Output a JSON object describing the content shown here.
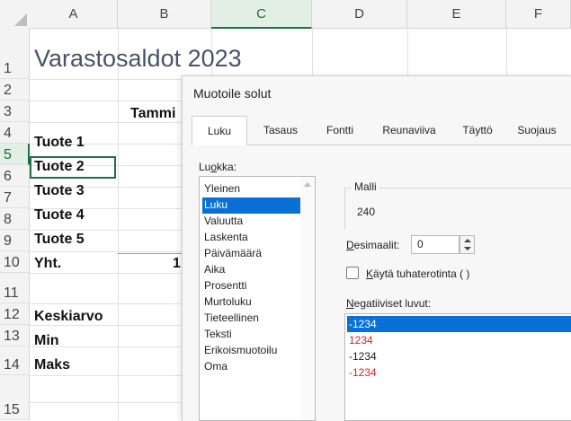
{
  "spreadsheet": {
    "columns": [
      "A",
      "B",
      "C",
      "D",
      "E",
      "F"
    ],
    "selected_column": "C",
    "rows": [
      "1",
      "2",
      "3",
      "4",
      "5",
      "6",
      "7",
      "8",
      "9",
      "10",
      "11",
      "12",
      "13",
      "14",
      "15"
    ],
    "selected_row": "5",
    "cells": {
      "a1": "Varastosaldot 2023",
      "b3": "Tammi",
      "a4": "Tuote 1",
      "a5": "Tuote 2",
      "a6": "Tuote 3",
      "a7": "Tuote 4",
      "a8": "Tuote 5",
      "a9": "Yht.",
      "b9": "1",
      "a11": "Keskiarvo",
      "a12": "Min",
      "a13": "Maks"
    }
  },
  "dialog": {
    "title": "Muotoile solut",
    "tabs": [
      "Luku",
      "Tasaus",
      "Fontti",
      "Reunaviiva",
      "Täyttö",
      "Suojaus"
    ],
    "active_tab": "Luku",
    "category_label": "Luokka:",
    "categories": [
      "Yleinen",
      "Luku",
      "Valuutta",
      "Laskenta",
      "Päivämäärä",
      "Aika",
      "Prosentti",
      "Murtoluku",
      "Tieteellinen",
      "Teksti",
      "Erikoismuotoilu",
      "Oma"
    ],
    "selected_category": "Luku",
    "sample_label": "Malli",
    "sample_value": "240",
    "decimals_label": "Desimaalit:",
    "decimals_value": "0",
    "thousands_label": "Käytä tuhaterotinta ( )",
    "thousands_checked": false,
    "negative_label": "Negatiiviset luvut:",
    "negative_options": [
      {
        "text": "-1234",
        "color": "#ffffff",
        "selected": true
      },
      {
        "text": "1234",
        "color": "#d9231e",
        "selected": false
      },
      {
        "text": "-1234",
        "color": "#222222",
        "selected": false
      },
      {
        "text": "-1234",
        "color": "#d9231e",
        "selected": false
      }
    ]
  },
  "colors": {
    "accent_green": "#1e7145",
    "selection_blue": "#0a6fd6",
    "title_text": "#44546a",
    "negative_red": "#d9231e"
  }
}
